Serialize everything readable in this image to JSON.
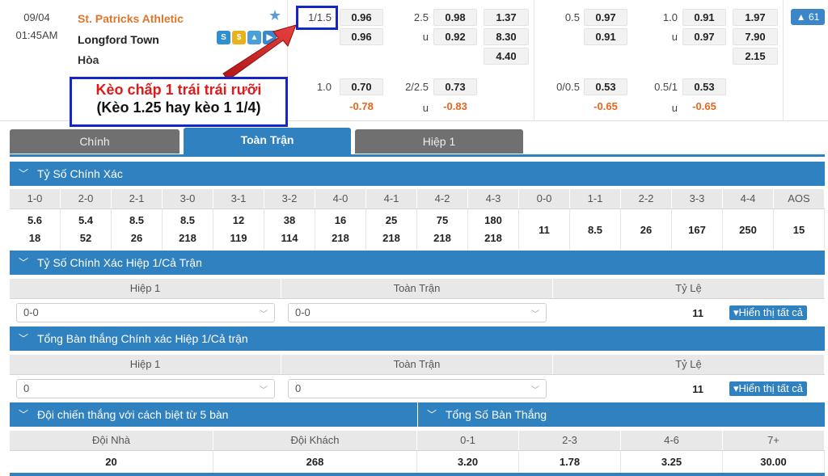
{
  "match": {
    "date": "09/04",
    "time": "01:45AM",
    "home_team": "St. Patricks Athletic",
    "away_team": "Longford Town",
    "draw_label": "Hòa",
    "more_count": "61"
  },
  "odds": {
    "ft_handicap_line": "1/1.5",
    "ft_handicap_home": "0.96",
    "ft_handicap_away": "0.96",
    "ft_ou_line": "2.5",
    "ft_ou_u": "u",
    "ft_ou_over": "0.98",
    "ft_ou_under": "0.92",
    "ft_1x2_home": "1.37",
    "ft_1x2_away": "8.30",
    "ft_1x2_draw": "4.40",
    "h1_handicap_line": "0.5",
    "h1_handicap_home": "0.97",
    "h1_handicap_away": "0.91",
    "h1_ou_line": "1.0",
    "h1_ou_u": "u",
    "h1_ou_over": "0.91",
    "h1_ou_under": "0.97",
    "h1_1x2_home": "1.97",
    "h1_1x2_away": "7.90",
    "h1_1x2_draw": "2.15",
    "alt_ft_handicap_line": "1.0",
    "alt_ft_handicap_home": "0.70",
    "alt_ft_handicap_away": "-0.78",
    "alt_ft_ou_line": "2/2.5",
    "alt_ft_ou_u": "u",
    "alt_ft_ou_over": "0.73",
    "alt_ft_ou_under": "-0.83",
    "alt_h1_handicap_line": "0/0.5",
    "alt_h1_handicap_home": "0.53",
    "alt_h1_handicap_away": "-0.65",
    "alt_h1_ou_line": "0.5/1",
    "alt_h1_ou_u": "u",
    "alt_h1_ou_over": "0.53",
    "alt_h1_ou_under": "-0.65"
  },
  "annotation": {
    "line1": "Kèo chấp 1 trái trái rưỡi",
    "line2": "(Kèo 1.25 hay kèo 1 1/4)"
  },
  "tabs": [
    "Chính",
    "Toàn Trận",
    "Hiệp 1"
  ],
  "correct_score": {
    "title": "Tỷ Số Chính Xác",
    "headers": [
      "1-0",
      "2-0",
      "2-1",
      "3-0",
      "3-1",
      "3-2",
      "4-0",
      "4-1",
      "4-2",
      "4-3",
      "0-0",
      "1-1",
      "2-2",
      "3-3",
      "4-4",
      "AOS"
    ],
    "home_values": [
      "5.6",
      "5.4",
      "8.5",
      "8.5",
      "12",
      "38",
      "16",
      "25",
      "75",
      "180"
    ],
    "away_values": [
      "18",
      "52",
      "26",
      "218",
      "119",
      "114",
      "218",
      "218",
      "218",
      "218"
    ],
    "draw_values": [
      "11",
      "8.5",
      "26",
      "167",
      "250",
      "15"
    ]
  },
  "ht_ft_score": {
    "title": "Tỷ Số Chính Xác Hiệp 1/Cả Trận",
    "col1": "Hiệp 1",
    "col2": "Toàn Trận",
    "col3": "Tỷ Lệ",
    "select1": "0-0",
    "select2": "0-0",
    "rate": "11",
    "show_all": "Hiển thị tất cả"
  },
  "ht_ft_goals": {
    "title": "Tổng Bàn thắng Chính xác Hiệp 1/Cả trận",
    "col1": "Hiệp 1",
    "col2": "Toàn Trận",
    "col3": "Tỷ Lệ",
    "select1": "0",
    "select2": "0",
    "rate": "11",
    "show_all": "Hiển thị tất cả"
  },
  "winning_margin": {
    "title": "Đội chiến thắng với cách biệt từ 5 bàn",
    "headers": [
      "Đội Nhà",
      "Đội Khách"
    ],
    "values": [
      "20",
      "268"
    ]
  },
  "total_goals": {
    "title": "Tổng Số Bàn Thắng",
    "headers": [
      "0-1",
      "2-3",
      "4-6",
      "7+"
    ],
    "values": [
      "3.20",
      "1.78",
      "3.25",
      "30.00"
    ]
  }
}
